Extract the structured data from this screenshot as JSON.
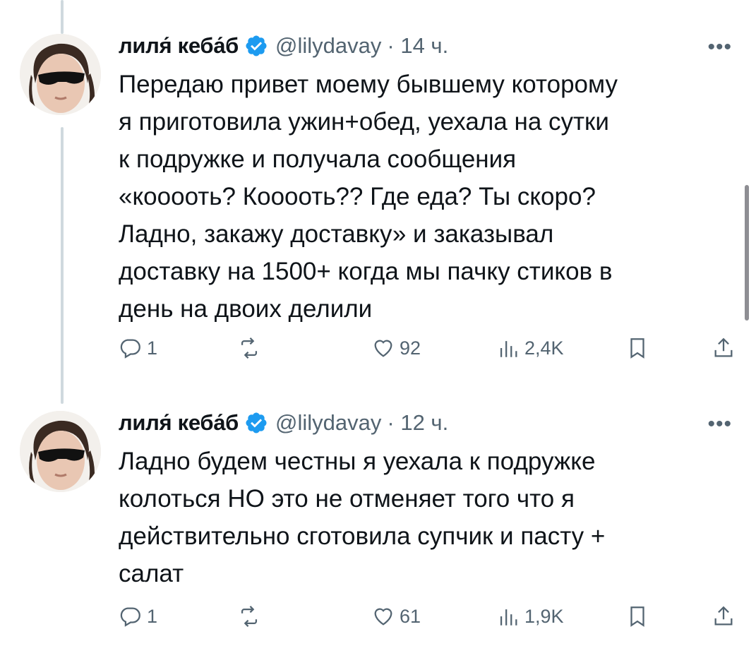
{
  "tweets": [
    {
      "author_name": "лиля́ кеба́б",
      "handle": "@lilydavay",
      "time": "· 14 ч.",
      "more": "•••",
      "text": "Передаю привет моему бывшему которому\nя приготовила ужин+обед, уехала на сутки\nк подружке и получала сообщения\n«кооооть? Кооооть?? Где еда? Ты скоро?\nЛадно, закажу доставку» и заказывал\nдоставку на 1500+ когда мы пачку стиков в\nдень на двоих делили",
      "replies": "1",
      "likes": "92",
      "views": "2,4K"
    },
    {
      "author_name": "лиля́ кеба́б",
      "handle": "@lilydavay",
      "time": "· 12 ч.",
      "more": "•••",
      "text": "Ладно будем честны я уехала к подружке\nколоться НО это не отменяет того что я\nдействительно сготовила супчик и пасту +\nсалат",
      "replies": "1",
      "likes": "61",
      "views": "1,9K"
    }
  ],
  "icons": {
    "reply": "reply-icon",
    "retweet": "retweet-icon",
    "like": "heart-icon",
    "views": "views-icon",
    "bookmark": "bookmark-icon",
    "share": "share-icon",
    "verified": "verified-badge-icon"
  },
  "colors": {
    "verified_blue": "#1d9bf0",
    "muted_gray": "#536471",
    "thread_line": "#cfd9de"
  }
}
